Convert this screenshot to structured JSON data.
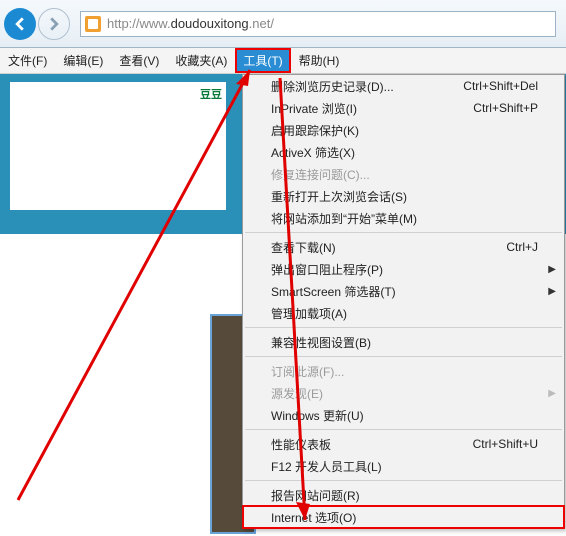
{
  "address": {
    "prefix": "http://",
    "host": "www.",
    "domain": "doudouxitong",
    "suffix": ".net/"
  },
  "menubar": {
    "file": "文件(F)",
    "edit": "编辑(E)",
    "view": "查看(V)",
    "favorites": "收藏夹(A)",
    "tools": "工具(T)",
    "help": "帮助(H)"
  },
  "bean_label": "豆豆",
  "dropdown": {
    "delete_history": "删除浏览历史记录(D)...",
    "delete_history_sc": "Ctrl+Shift+Del",
    "inprivate": "InPrivate 浏览(I)",
    "inprivate_sc": "Ctrl+Shift+P",
    "tracking": "启用跟踪保护(K)",
    "activex": "ActiveX 筛选(X)",
    "fix_conn": "修复连接问题(C)...",
    "reopen": "重新打开上次浏览会话(S)",
    "add_start": "将网站添加到“开始”菜单(M)",
    "view_dl": "查看下载(N)",
    "view_dl_sc": "Ctrl+J",
    "popup": "弹出窗口阻止程序(P)",
    "smartscreen": "SmartScreen 筛选器(T)",
    "addons": "管理加载项(A)",
    "compat": "兼容性视图设置(B)",
    "feeds": "订阅此源(F)...",
    "feed_discover": "源发现(E)",
    "win_update": "Windows 更新(U)",
    "perf": "性能仪表板",
    "perf_sc": "Ctrl+Shift+U",
    "f12": "F12 开发人员工具(L)",
    "report": "报告网站问题(R)",
    "options": "Internet 选项(O)"
  }
}
